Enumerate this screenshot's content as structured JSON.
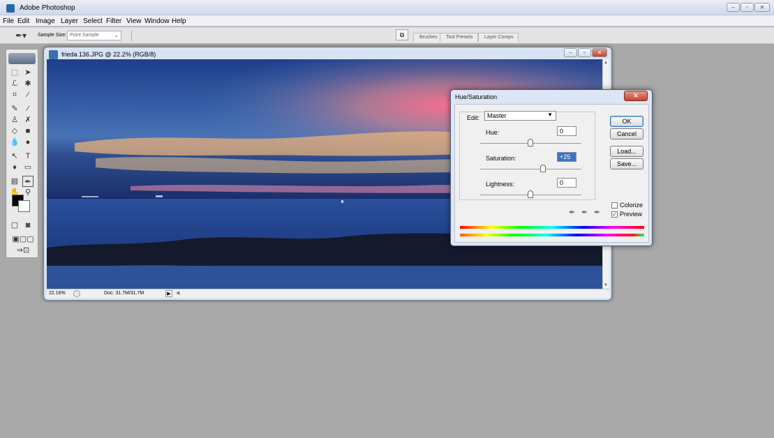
{
  "app": {
    "title": "Adobe Photoshop",
    "window_controls": [
      "–",
      "▫",
      "✕"
    ]
  },
  "menu": [
    "File",
    "Edit",
    "Image",
    "Layer",
    "Select",
    "Filter",
    "View",
    "Window",
    "Help"
  ],
  "options_bar": {
    "tool_icon": "eyedropper-icon",
    "sample_size_label": "Sample Size:",
    "sample_size_value": "Point Sample",
    "palette_tabs": [
      "Brushes",
      "Tool Presets",
      "Layer Comps"
    ]
  },
  "toolbox": {
    "tools": [
      "marquee-tool",
      "move-tool",
      "lasso-tool",
      "magic-wand-tool",
      "crop-tool",
      "slice-tool",
      "healing-brush-tool",
      "brush-tool",
      "clone-stamp-tool",
      "history-brush-tool",
      "eraser-tool",
      "gradient-tool",
      "blur-tool",
      "dodge-tool",
      "path-selection-tool",
      "type-tool",
      "pen-tool",
      "shape-tool",
      "notes-tool",
      "eyedropper-tool",
      "hand-tool",
      "zoom-tool"
    ],
    "foreground_color": "#000000",
    "background_color": "#ffffff"
  },
  "document": {
    "title": "frieda 136.JPG @ 22.2% (RGB/8)",
    "zoom": "22.16%",
    "doc_size": "Doc: 31.7M/31.7M"
  },
  "dialog": {
    "title": "Hue/Saturation",
    "edit_label": "Edit:",
    "edit_value": "Master",
    "hue_label": "Hue:",
    "hue_value": "0",
    "saturation_label": "Saturation:",
    "saturation_value": "+25",
    "lightness_label": "Lightness:",
    "lightness_value": "0",
    "buttons": {
      "ok": "OK",
      "cancel": "Cancel",
      "load": "Load...",
      "save": "Save..."
    },
    "colorize_label": "Colorize",
    "colorize_checked": false,
    "preview_label": "Preview",
    "preview_checked": true
  }
}
